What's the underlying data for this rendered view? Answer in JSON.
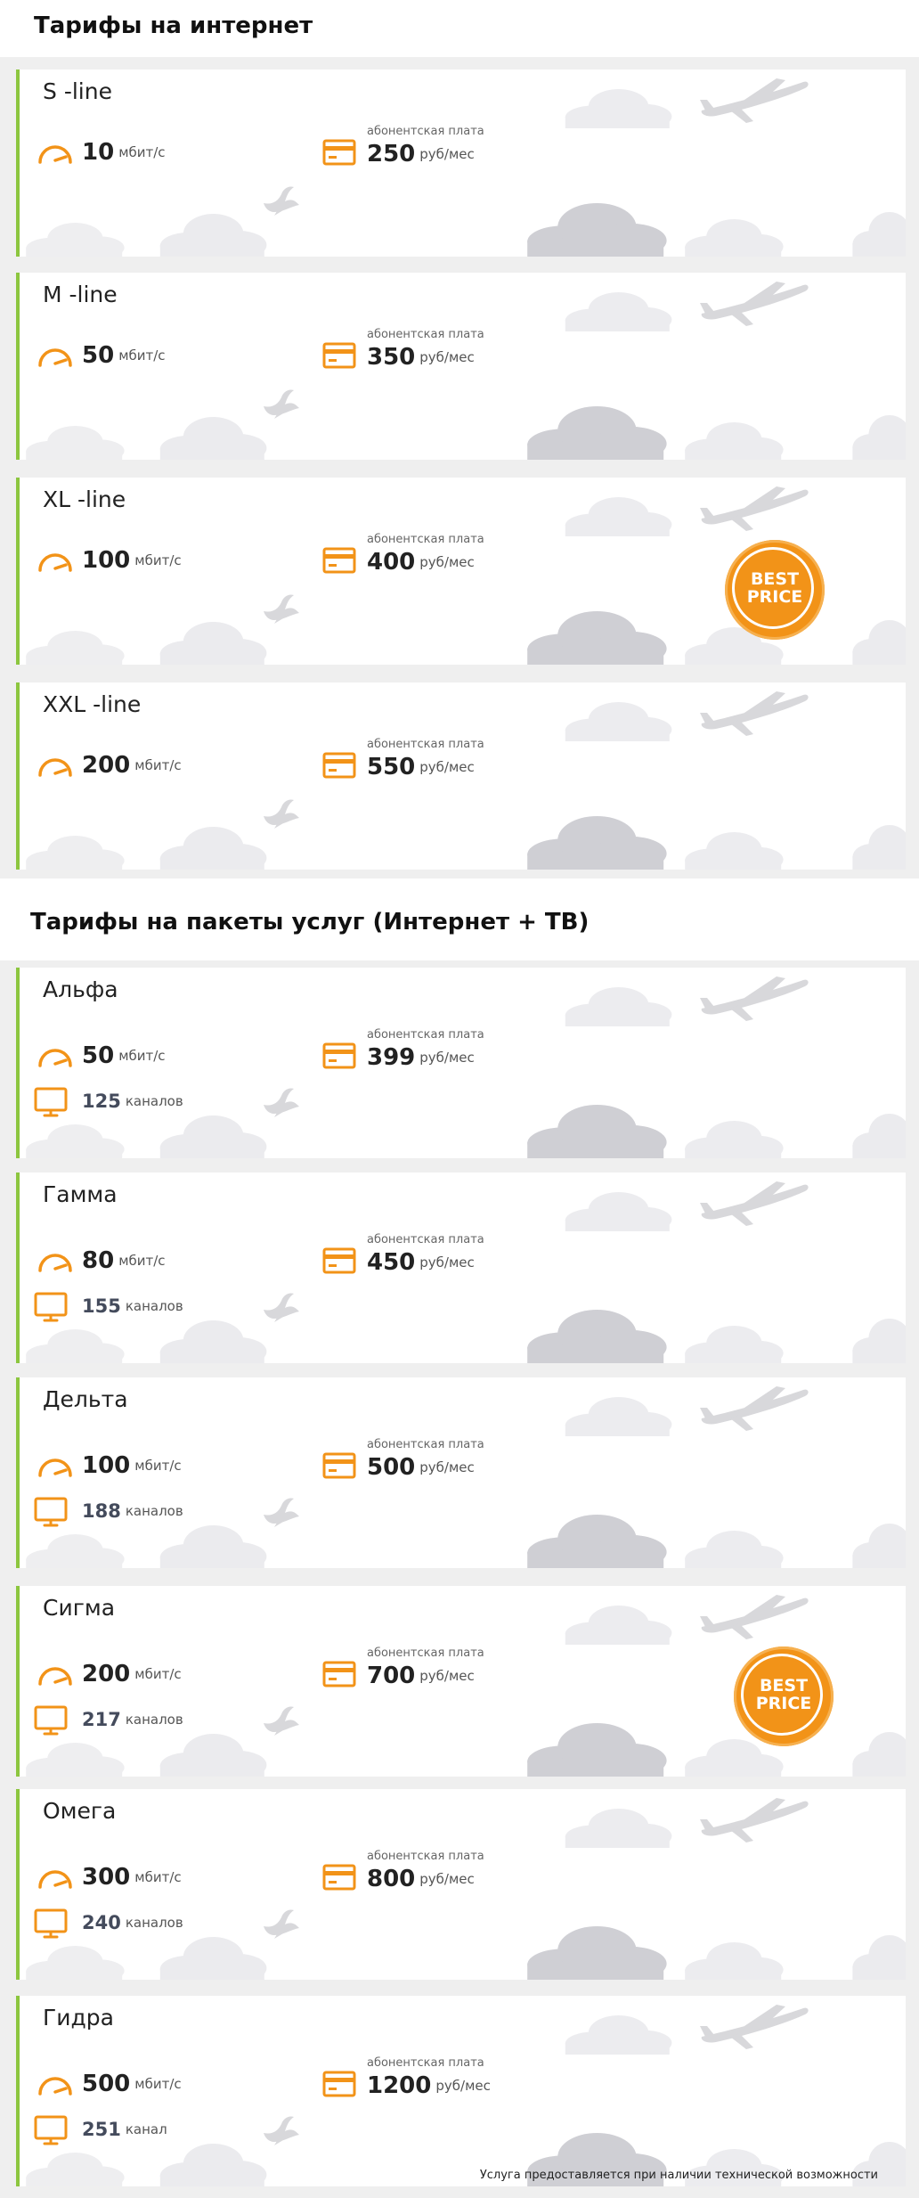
{
  "sections": [
    {
      "title": "Тарифы на  интернет"
    },
    {
      "title": "Тарифы на пакеты услуг (Интернет + ТВ)"
    }
  ],
  "internet_plans": [
    {
      "name": "S -line",
      "speed": "10",
      "speed_unit": "мбит/с",
      "fee_label": "абонентская плата",
      "price": "250",
      "price_unit": "руб/мес",
      "best": false
    },
    {
      "name": "M -line",
      "speed": "50",
      "speed_unit": "мбит/с",
      "fee_label": "абонентская плата",
      "price": "350",
      "price_unit": "руб/мес",
      "best": false
    },
    {
      "name": "XL -line",
      "speed": "100",
      "speed_unit": "мбит/с",
      "fee_label": "абонентская плата",
      "price": "400",
      "price_unit": "руб/мес",
      "best": true
    },
    {
      "name": "XXL -line",
      "speed": "200",
      "speed_unit": "мбит/с",
      "fee_label": "абонентская плата",
      "price": "550",
      "price_unit": "руб/мес",
      "best": false
    }
  ],
  "bundle_plans": [
    {
      "name": "Альфа",
      "speed": "50",
      "speed_unit": "мбит/с",
      "channels": "125",
      "channels_unit": "каналов",
      "fee_label": "абонентская плата",
      "price": "399",
      "price_unit": "руб/мес",
      "best": false
    },
    {
      "name": "Гамма",
      "speed": "80",
      "speed_unit": "мбит/с",
      "channels": "155",
      "channels_unit": "каналов",
      "fee_label": "абонентская плата",
      "price": "450",
      "price_unit": "руб/мес",
      "best": false
    },
    {
      "name": "Дельта",
      "speed": "100",
      "speed_unit": "мбит/с",
      "channels": "188",
      "channels_unit": "каналов",
      "fee_label": "абонентская плата",
      "price": "500",
      "price_unit": "руб/мес",
      "best": false
    },
    {
      "name": "Сигма",
      "speed": "200",
      "speed_unit": "мбит/с",
      "channels": "217",
      "channels_unit": "каналов",
      "fee_label": "абонентская плата",
      "price": "700",
      "price_unit": "руб/мес",
      "best": true
    },
    {
      "name": "Омега",
      "speed": "300",
      "speed_unit": "мбит/с",
      "channels": "240",
      "channels_unit": "каналов",
      "fee_label": "абонентская плата",
      "price": "800",
      "price_unit": "руб/мес",
      "best": false
    },
    {
      "name": "Гидра",
      "speed": "500",
      "speed_unit": "мбит/с",
      "channels": "251",
      "channels_unit": "канал",
      "fee_label": "абонентская плата",
      "price": "1200",
      "price_unit": "руб/мес",
      "best": false
    }
  ],
  "badge": {
    "line1": "BEST",
    "line2": "PRICE"
  },
  "footnote": "Услуга предоставляется при наличии технической возможности",
  "colors": {
    "accent": "#f29318",
    "card_border": "#8cc63f",
    "background_band": "#efefef",
    "decor": "#d8d8db"
  },
  "icons": {
    "speed": "speedometer-icon",
    "price": "credit-card-icon",
    "tv": "tv-monitor-icon",
    "decor": [
      "airplane-icon",
      "bird-icon",
      "cloud-icon"
    ]
  }
}
